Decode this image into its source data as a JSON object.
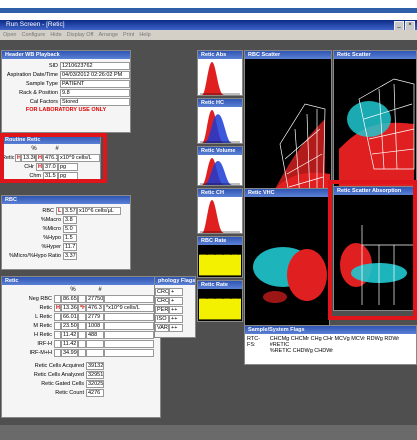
{
  "window": {
    "title": "Run Screen - [Retic]"
  },
  "menu": [
    "Open",
    "Configure",
    "Hide",
    "Display Off",
    "Arrange",
    "Print",
    "Help"
  ],
  "header_panel": {
    "title": "Header  WB  Playback",
    "rows": [
      {
        "label": "SID",
        "value": "1210623762"
      },
      {
        "label": "Aspiration Date/Time",
        "value": "04/03/2012 02:26:02 PM"
      },
      {
        "label": "Sample Type",
        "value": "PATIENT"
      },
      {
        "label": "Rack & Position",
        "value": "9.8"
      },
      {
        "label": "Cal Factors",
        "value": "Stored"
      }
    ],
    "warning": "FOR LABORATORY USE ONLY"
  },
  "routine_retic": {
    "title": "Routine Retic",
    "col_pct": "%",
    "col_num": "#",
    "rows": [
      {
        "label": "Retic",
        "flag1": "H",
        "pct": "13.36",
        "flag2": "H",
        "num": "476.3",
        "unit": "x10^9 cells/L"
      },
      {
        "label": "CHr",
        "flag1": "",
        "pct": "",
        "flag2": "H",
        "num": "37.0",
        "unit": "pg"
      },
      {
        "label": "Chm",
        "flag1": "",
        "pct": "",
        "flag2": "",
        "num": "31.5",
        "unit": "pg"
      }
    ]
  },
  "rbc_panel": {
    "title": "RBC",
    "rows": [
      {
        "label": "RBC",
        "flag": "L",
        "value": "3.57",
        "unit": "x10^6 cells/μL"
      },
      {
        "label": "%Macro",
        "flag": "",
        "value": "3.8",
        "unit": ""
      },
      {
        "label": "%Micro",
        "flag": "",
        "value": "5.0",
        "unit": ""
      },
      {
        "label": "%Hypo",
        "flag": "",
        "value": "1.5",
        "unit": ""
      },
      {
        "label": "%Hyper",
        "flag": "",
        "value": "11.7",
        "unit": ""
      },
      {
        "label": "%Micro/%Hypo Ratio",
        "flag": "",
        "value": "3.37",
        "unit": ""
      }
    ]
  },
  "retic_panel": {
    "title": "Retic",
    "col_pct": "%",
    "col_num": "#",
    "rows": [
      {
        "label": "Neg RBC",
        "f1": "",
        "pct": "86.65",
        "f2": "",
        "num": "27750",
        "unit": ""
      },
      {
        "label": "Retic",
        "f1": "H",
        "pct": "13.36",
        "f2": "*H",
        "num": "476.3",
        "unit": "*x10^9 cells/L"
      },
      {
        "label": "L Retic",
        "f1": "",
        "pct": "66.01",
        "f2": "",
        "num": "2779",
        "unit": ""
      },
      {
        "label": "M Retic",
        "f1": "",
        "pct": "23.50",
        "f2": "",
        "num": "1008",
        "unit": ""
      },
      {
        "label": "H Retic",
        "f1": "",
        "pct": "11.42",
        "f2": "",
        "num": "488",
        "unit": ""
      },
      {
        "label": "IRF-H",
        "f1": "",
        "pct": "11.42",
        "f2": "",
        "num": "",
        "unit": ""
      },
      {
        "label": "IRF-M+H",
        "f1": "",
        "pct": "34.99",
        "f2": "",
        "num": "",
        "unit": ""
      }
    ],
    "counts": [
      {
        "label": "Retic Cells Acquired",
        "value": "39132"
      },
      {
        "label": "Retic Cells Analyzed",
        "value": "32951"
      },
      {
        "label": "Retic Gated Cells",
        "value": "32025"
      },
      {
        "label": "Retic Count",
        "value": "4276"
      }
    ]
  },
  "morphology_flags": {
    "title": "phology Flags",
    "rows": [
      {
        "label": "CRO",
        "value": "+"
      },
      {
        "label": "CRO",
        "value": "+"
      },
      {
        "label": "PER",
        "value": "++"
      },
      {
        "label": "ISO",
        "value": "++"
      },
      {
        "label": "VAR",
        "value": "++"
      }
    ]
  },
  "histograms": [
    {
      "title": "Retic Abs"
    },
    {
      "title": "Retic HC"
    },
    {
      "title": "Retic Volume"
    },
    {
      "title": "Retic CH"
    },
    {
      "title": "RBC Rate"
    },
    {
      "title": "Retic Rate"
    }
  ],
  "scatters": {
    "rbc": "RBC Scatter",
    "retic": "Retic Scatter",
    "retic_vhc": "Retic VHC",
    "absorption": "Retic Scatter Absorption"
  },
  "sample_flags": {
    "title": "Sample/System Flags",
    "code": "RTC-FS:",
    "line1": "CHCMg CHCMr CHg CHr MCVg MCVr RDWg RDWr #RETIC",
    "line2": "%RETIC CHDWg CHDWr"
  },
  "colors": {
    "accent": "#2f55b3",
    "highlight": "#e0151b",
    "cyan": "#20c8d0",
    "red": "#e02020",
    "yellow": "#f3f000"
  }
}
